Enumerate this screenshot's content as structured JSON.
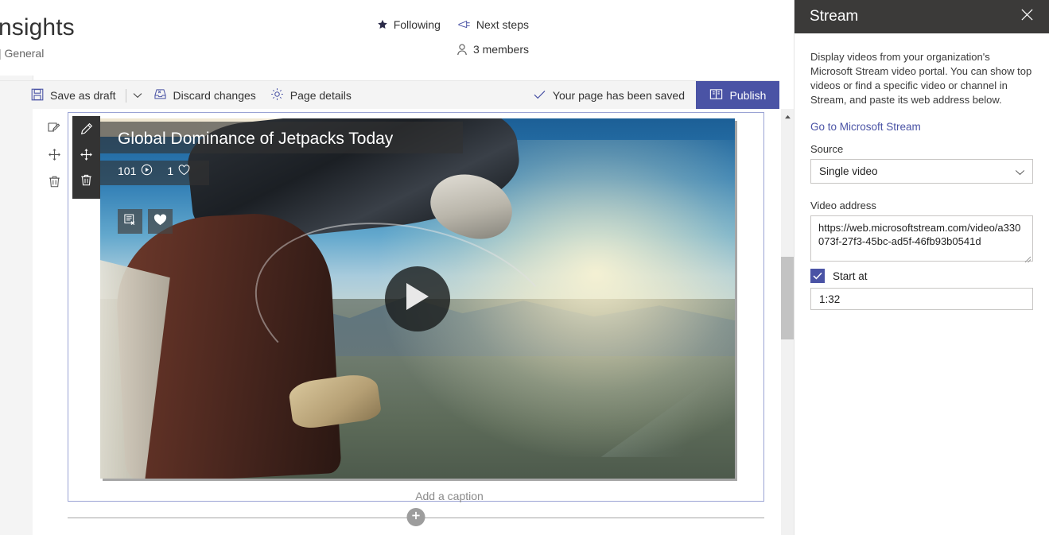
{
  "header": {
    "site_title": "nsights",
    "site_subtitle": "| General",
    "following_label": "Following",
    "next_steps_label": "Next steps",
    "members_label": "3 members",
    "following_icon": "star-icon",
    "next_steps_icon": "megaphone-icon",
    "members_icon": "person-icon"
  },
  "commandbar": {
    "save_draft_label": "Save as draft",
    "save_draft_icon": "save-disk-icon",
    "caret_icon": "chevron-down-icon",
    "discard_label": "Discard changes",
    "discard_icon": "discard-tray-icon",
    "page_details_label": "Page details",
    "page_details_icon": "gear-icon",
    "saved_status": "Your page has been saved",
    "saved_icon": "checkmark-icon",
    "publish_label": "Publish",
    "publish_icon": "publish-book-icon",
    "publish_color": "#4a53a5"
  },
  "canvas": {
    "rail_tools": [
      {
        "name": "edit-webpart",
        "icon": "pencil-page-icon"
      },
      {
        "name": "move-webpart",
        "icon": "move-arrows-icon"
      },
      {
        "name": "delete-webpart",
        "icon": "trash-icon"
      }
    ],
    "webpart_tools": [
      {
        "name": "edit-webpart",
        "icon": "pencil-icon"
      },
      {
        "name": "move-webpart",
        "icon": "move-arrows-icon"
      },
      {
        "name": "delete-webpart",
        "icon": "trash-icon"
      }
    ],
    "video": {
      "title": "Global Dominance of Jetpacks Today",
      "views": "101",
      "views_icon": "play-circle-icon",
      "likes": "1",
      "likes_icon": "heart-outline-icon",
      "action_cc": "closed-captions-off-icon",
      "action_like": "heart-filled-icon",
      "play_icon": "play-triangle-icon"
    },
    "caption_placeholder": "Add a caption",
    "add_section_icon": "plus-icon",
    "section_border_color": "#9aa3d4"
  },
  "scrollbar": {
    "up_arrow_icon": "caret-up-icon"
  },
  "panel": {
    "title": "Stream",
    "close_icon": "close-icon",
    "description": "Display videos from your organization's Microsoft Stream video portal. You can show top videos or find a specific video or channel in Stream, and paste its web address below.",
    "link_label": "Go to Microsoft Stream",
    "source_label": "Source",
    "source_value": "Single video",
    "source_caret_icon": "chevron-down-icon",
    "video_address_label": "Video address",
    "video_address_value": "https://web.microsoftstream.com/video/a330073f-27f3-45bc-ad5f-46fb93b0541d",
    "start_at_label": "Start at",
    "start_at_checked": true,
    "start_at_value": "1:32",
    "accent_color": "#4a53a5"
  }
}
